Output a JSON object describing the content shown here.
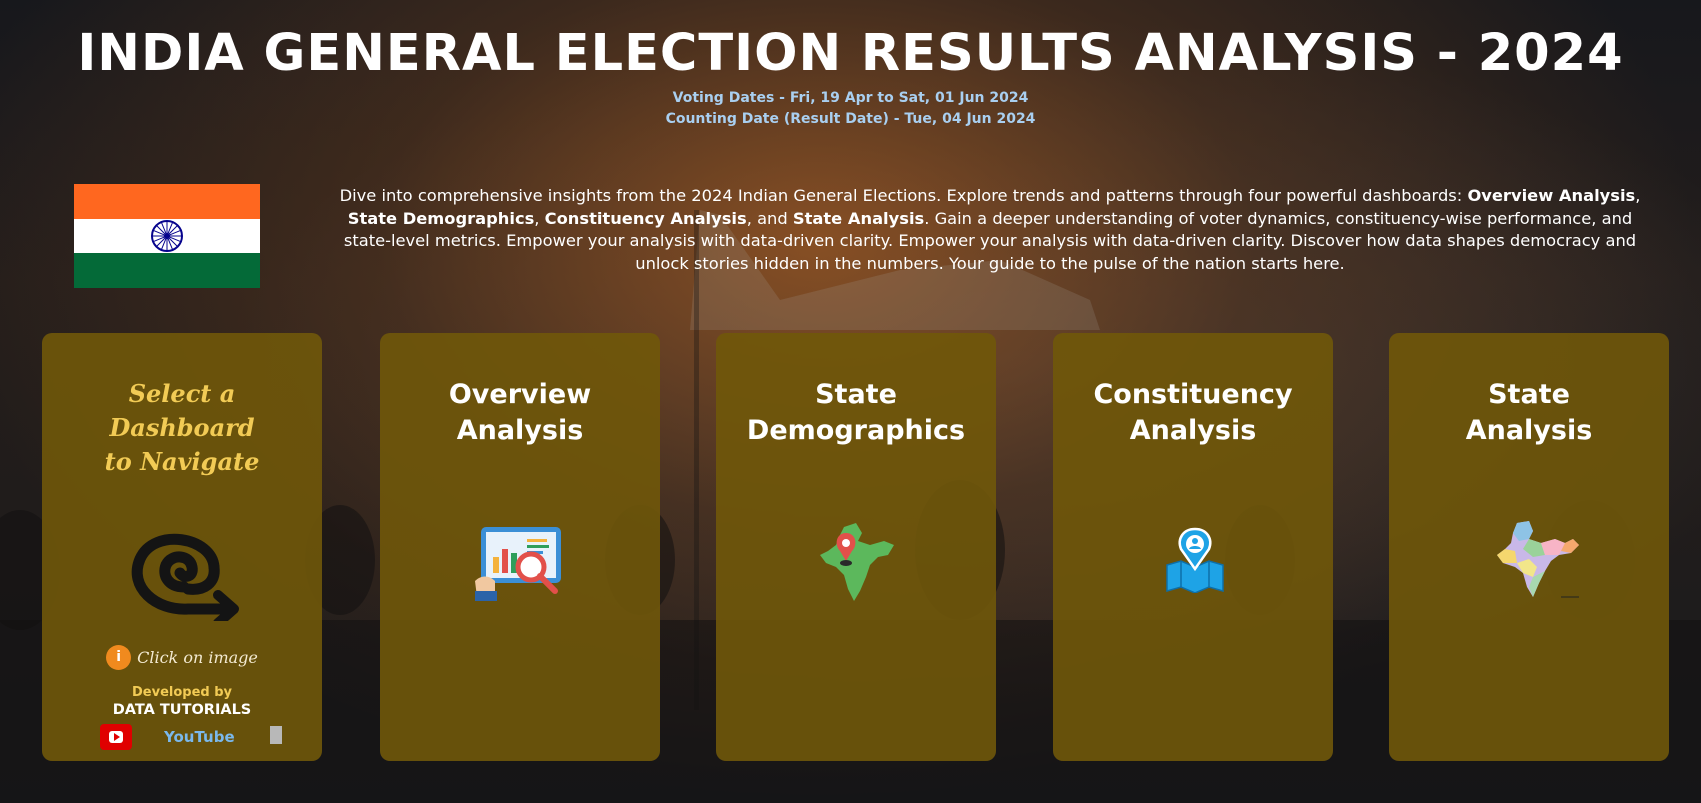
{
  "header": {
    "title": "INDIA GENERAL ELECTION RESULTS ANALYSIS - 2024",
    "voting_dates": "Voting Dates - Fri, 19 Apr to Sat, 01 Jun 2024",
    "counting_date": "Counting Date (Result Date) - Tue, 04 Jun 2024"
  },
  "intro": {
    "part1": "Dive into comprehensive insights from the 2024 Indian General Elections. Explore trends and patterns through four powerful dashboards: ",
    "bold1": "Overview Analysis",
    "sep1": ", ",
    "bold2": "State Demographics",
    "sep2": ", ",
    "bold3": "Constituency Analysis",
    "sep3": ", and ",
    "bold4": "State Analysis",
    "part2": ". Gain a deeper understanding of voter dynamics, constituency-wise performance, and state-level metrics. Empower your analysis with data-driven clarity. Empower your analysis with data-driven clarity. Discover how data shapes democracy and unlock stories hidden in the numbers. Your guide to the pulse of the nation starts here."
  },
  "nav_card": {
    "line1": "Select a",
    "line2": "Dashboard",
    "line3": "to Navigate",
    "hint": "Click on image",
    "developed_by": "Developed by",
    "developer": "DATA TUTORIALS",
    "youtube": "YouTube"
  },
  "cards": [
    {
      "line1": "Overview",
      "line2": "Analysis",
      "icon": "analytics-report-icon"
    },
    {
      "line1": "State",
      "line2": "Demographics",
      "icon": "india-map-pin-icon"
    },
    {
      "line1": "Constituency",
      "line2": "Analysis",
      "icon": "location-map-icon"
    },
    {
      "line1": "State",
      "line2": "Analysis",
      "icon": "india-states-map-icon"
    }
  ],
  "colors": {
    "card_bg": "#70580a",
    "nav_title": "#f2cb55",
    "subtitle": "#a9cff0",
    "saffron": "#ff671f",
    "green": "#046a38",
    "chakra": "#06038d"
  }
}
